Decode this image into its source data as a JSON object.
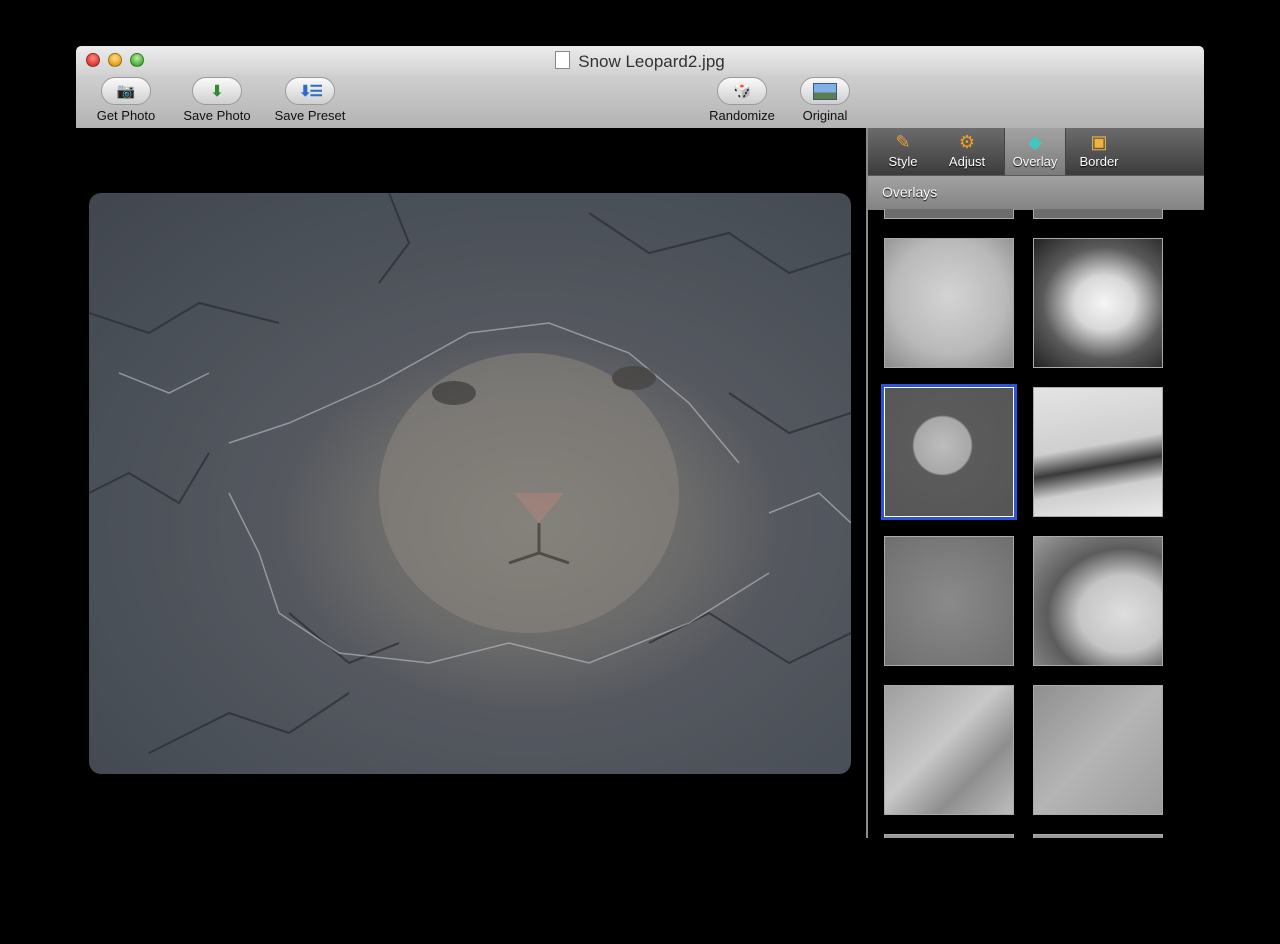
{
  "window": {
    "title": "Snow Leopard2.jpg"
  },
  "toolbar": {
    "get_photo": "Get Photo",
    "save_photo": "Save Photo",
    "save_preset": "Save Preset",
    "randomize": "Randomize",
    "original": "Original"
  },
  "sidebar": {
    "tabs": [
      {
        "label": "Style",
        "icon": "brush-icon",
        "selected": false
      },
      {
        "label": "Adjust",
        "icon": "gear-icon",
        "selected": false
      },
      {
        "label": "Overlay",
        "icon": "overlay-layers-icon",
        "selected": true
      },
      {
        "label": "Border",
        "icon": "border-frame-icon",
        "selected": false
      }
    ],
    "panel_title": "Overlays",
    "selected_overlay_index": 2
  },
  "canvas": {
    "image_subject": "snow-leopard-photo"
  }
}
